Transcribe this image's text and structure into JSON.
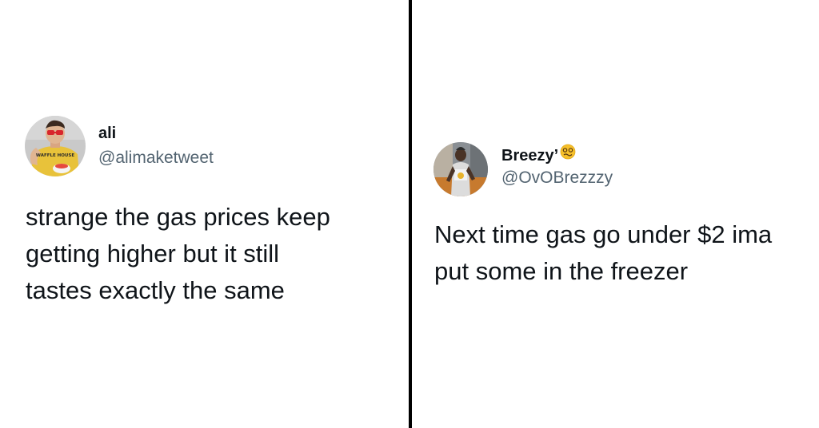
{
  "tweets": [
    {
      "display_name": "ali",
      "handle": "@alimaketweet",
      "text_lines": [
        "strange the gas prices keep",
        "getting higher but it still",
        "tastes exactly the same"
      ],
      "avatar_icon": "profile-photo-icon",
      "avatar_shirt_text": "WAFFLE HOUSE",
      "colors": {
        "shirt": "#e8c23a",
        "glasses": "#d8262c",
        "background": "#c9c9c9"
      }
    },
    {
      "display_name": "Breezy’",
      "handle": "@OvOBrezzzy",
      "name_emoji": "woozy-face-icon",
      "text_lines": [
        "Next time gas go under $2 ima",
        "put some in the freezer"
      ],
      "avatar_icon": "profile-photo-icon",
      "colors": {
        "emoji": "#f7c02a",
        "background": "#8a8f94"
      }
    }
  ],
  "theme": {
    "text": "#0f1419",
    "secondary_text": "#536471",
    "divider": "#000000",
    "background": "#ffffff"
  }
}
